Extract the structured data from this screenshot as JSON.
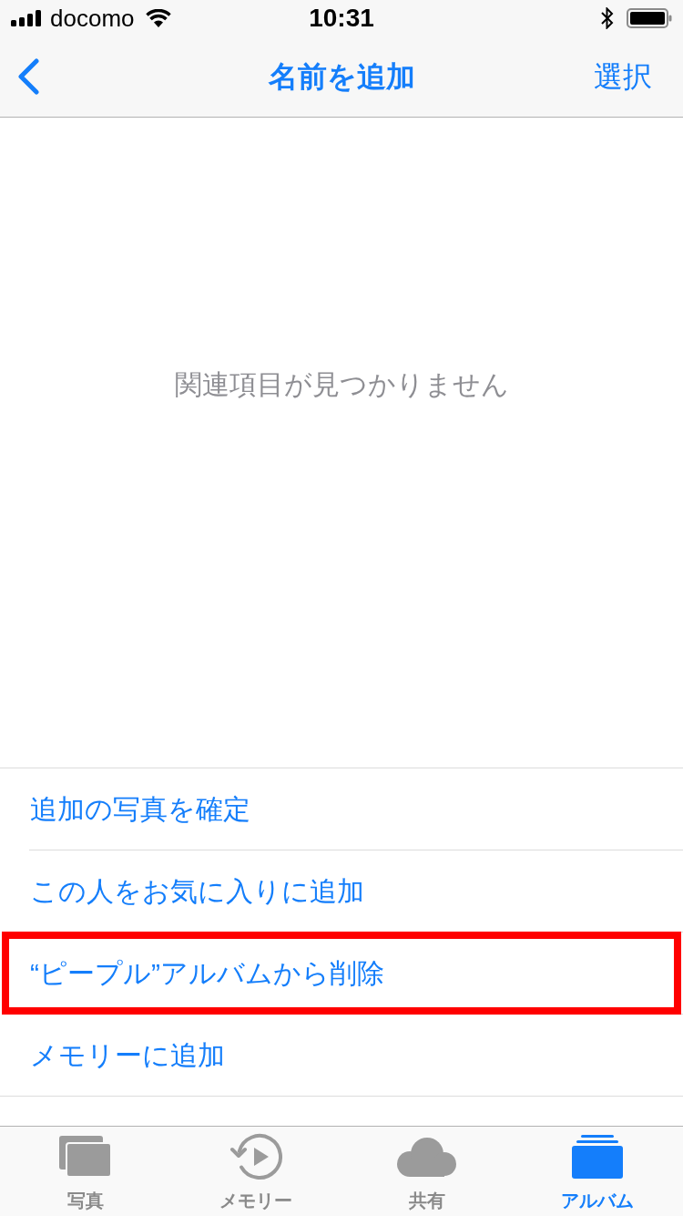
{
  "status_bar": {
    "carrier": "docomo",
    "time": "10:31"
  },
  "nav_bar": {
    "title": "名前を追加",
    "action": "選択"
  },
  "empty_message": "関連項目が見つかりません",
  "actions": [
    {
      "label": "追加の写真を確定",
      "highlighted": false
    },
    {
      "label": "この人をお気に入りに追加",
      "highlighted": false
    },
    {
      "label": "“ピープル”アルバムから削除",
      "highlighted": true
    },
    {
      "label": "メモリーに追加",
      "highlighted": false
    }
  ],
  "tab_bar": [
    {
      "label": "写真",
      "kind": "photos",
      "selected": false
    },
    {
      "label": "メモリー",
      "kind": "memories",
      "selected": false
    },
    {
      "label": "共有",
      "kind": "shared",
      "selected": false
    },
    {
      "label": "アルバム",
      "kind": "albums",
      "selected": true
    }
  ]
}
